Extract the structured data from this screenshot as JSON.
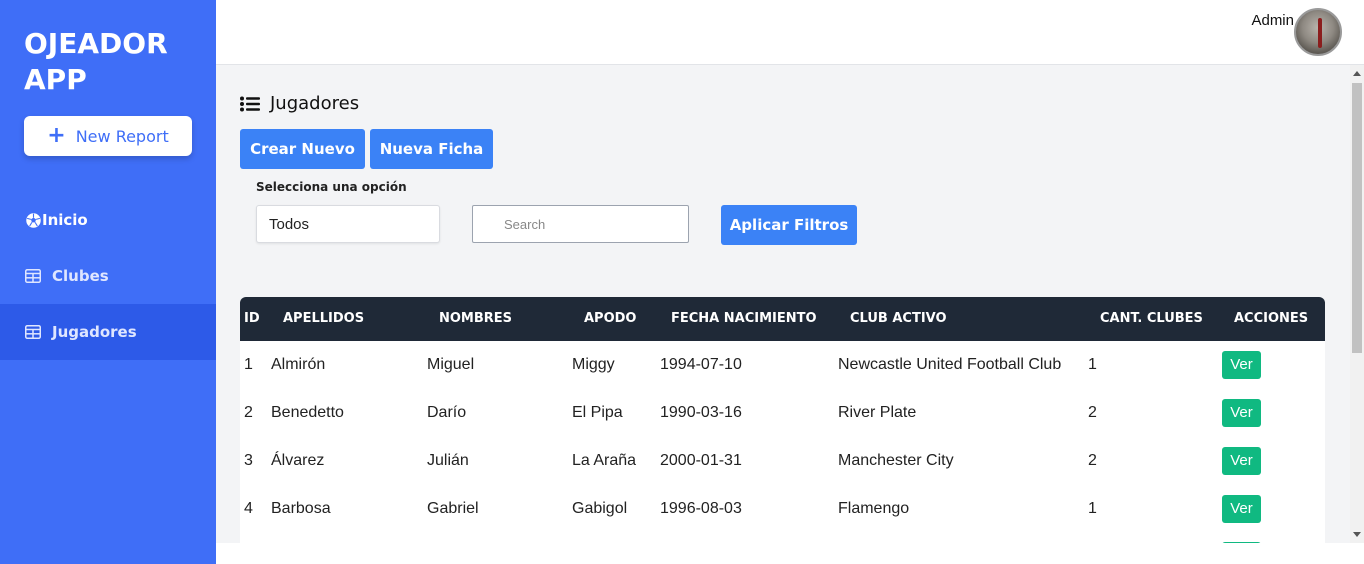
{
  "sidebar": {
    "brand": "OJEADOR APP",
    "new_report_label": "New Report",
    "items": [
      {
        "label": "Inicio",
        "icon": "soccer-ball-icon"
      },
      {
        "label": "Clubes",
        "icon": "table-icon"
      },
      {
        "label": "Jugadores",
        "icon": "table-icon",
        "active": true
      }
    ]
  },
  "header": {
    "user_name": "Admin"
  },
  "page": {
    "title": "Jugadores",
    "crear_label": "Crear Nuevo",
    "ficha_label": "Nueva Ficha",
    "filter_label": "Selecciona una opción",
    "select_value": "Todos",
    "search_placeholder": "Search",
    "apply_label": "Aplicar Filtros"
  },
  "table": {
    "headers": [
      "ID",
      "APELLIDOS",
      "NOMBRES",
      "APODO",
      "FECHA NACIMIENTO",
      "CLUB ACTIVO",
      "CANT. CLUBES",
      "ACCIONES"
    ],
    "rows": [
      {
        "id": "1",
        "apellidos": "Almirón",
        "nombres": "Miguel",
        "apodo": "Miggy",
        "fecha": "1994-07-10",
        "club": "Newcastle United Football Club",
        "cant": "1",
        "accion": "Ver"
      },
      {
        "id": "2",
        "apellidos": "Benedetto",
        "nombres": "Darío",
        "apodo": "El Pipa",
        "fecha": "1990-03-16",
        "club": "River Plate",
        "cant": "2",
        "accion": "Ver"
      },
      {
        "id": "3",
        "apellidos": "Álvarez",
        "nombres": "Julián",
        "apodo": "La Araña",
        "fecha": "2000-01-31",
        "club": "Manchester City",
        "cant": "2",
        "accion": "Ver"
      },
      {
        "id": "4",
        "apellidos": "Barbosa",
        "nombres": "Gabriel",
        "apodo": "Gabigol",
        "fecha": "1996-08-03",
        "club": "Flamengo",
        "cant": "1",
        "accion": "Ver"
      }
    ]
  },
  "colors": {
    "sidebar": "#3f6ef7",
    "sidebar_active": "#2d5ae8",
    "primary_button": "#3b82f6",
    "table_header": "#1f2937",
    "action_button": "#10b981"
  }
}
